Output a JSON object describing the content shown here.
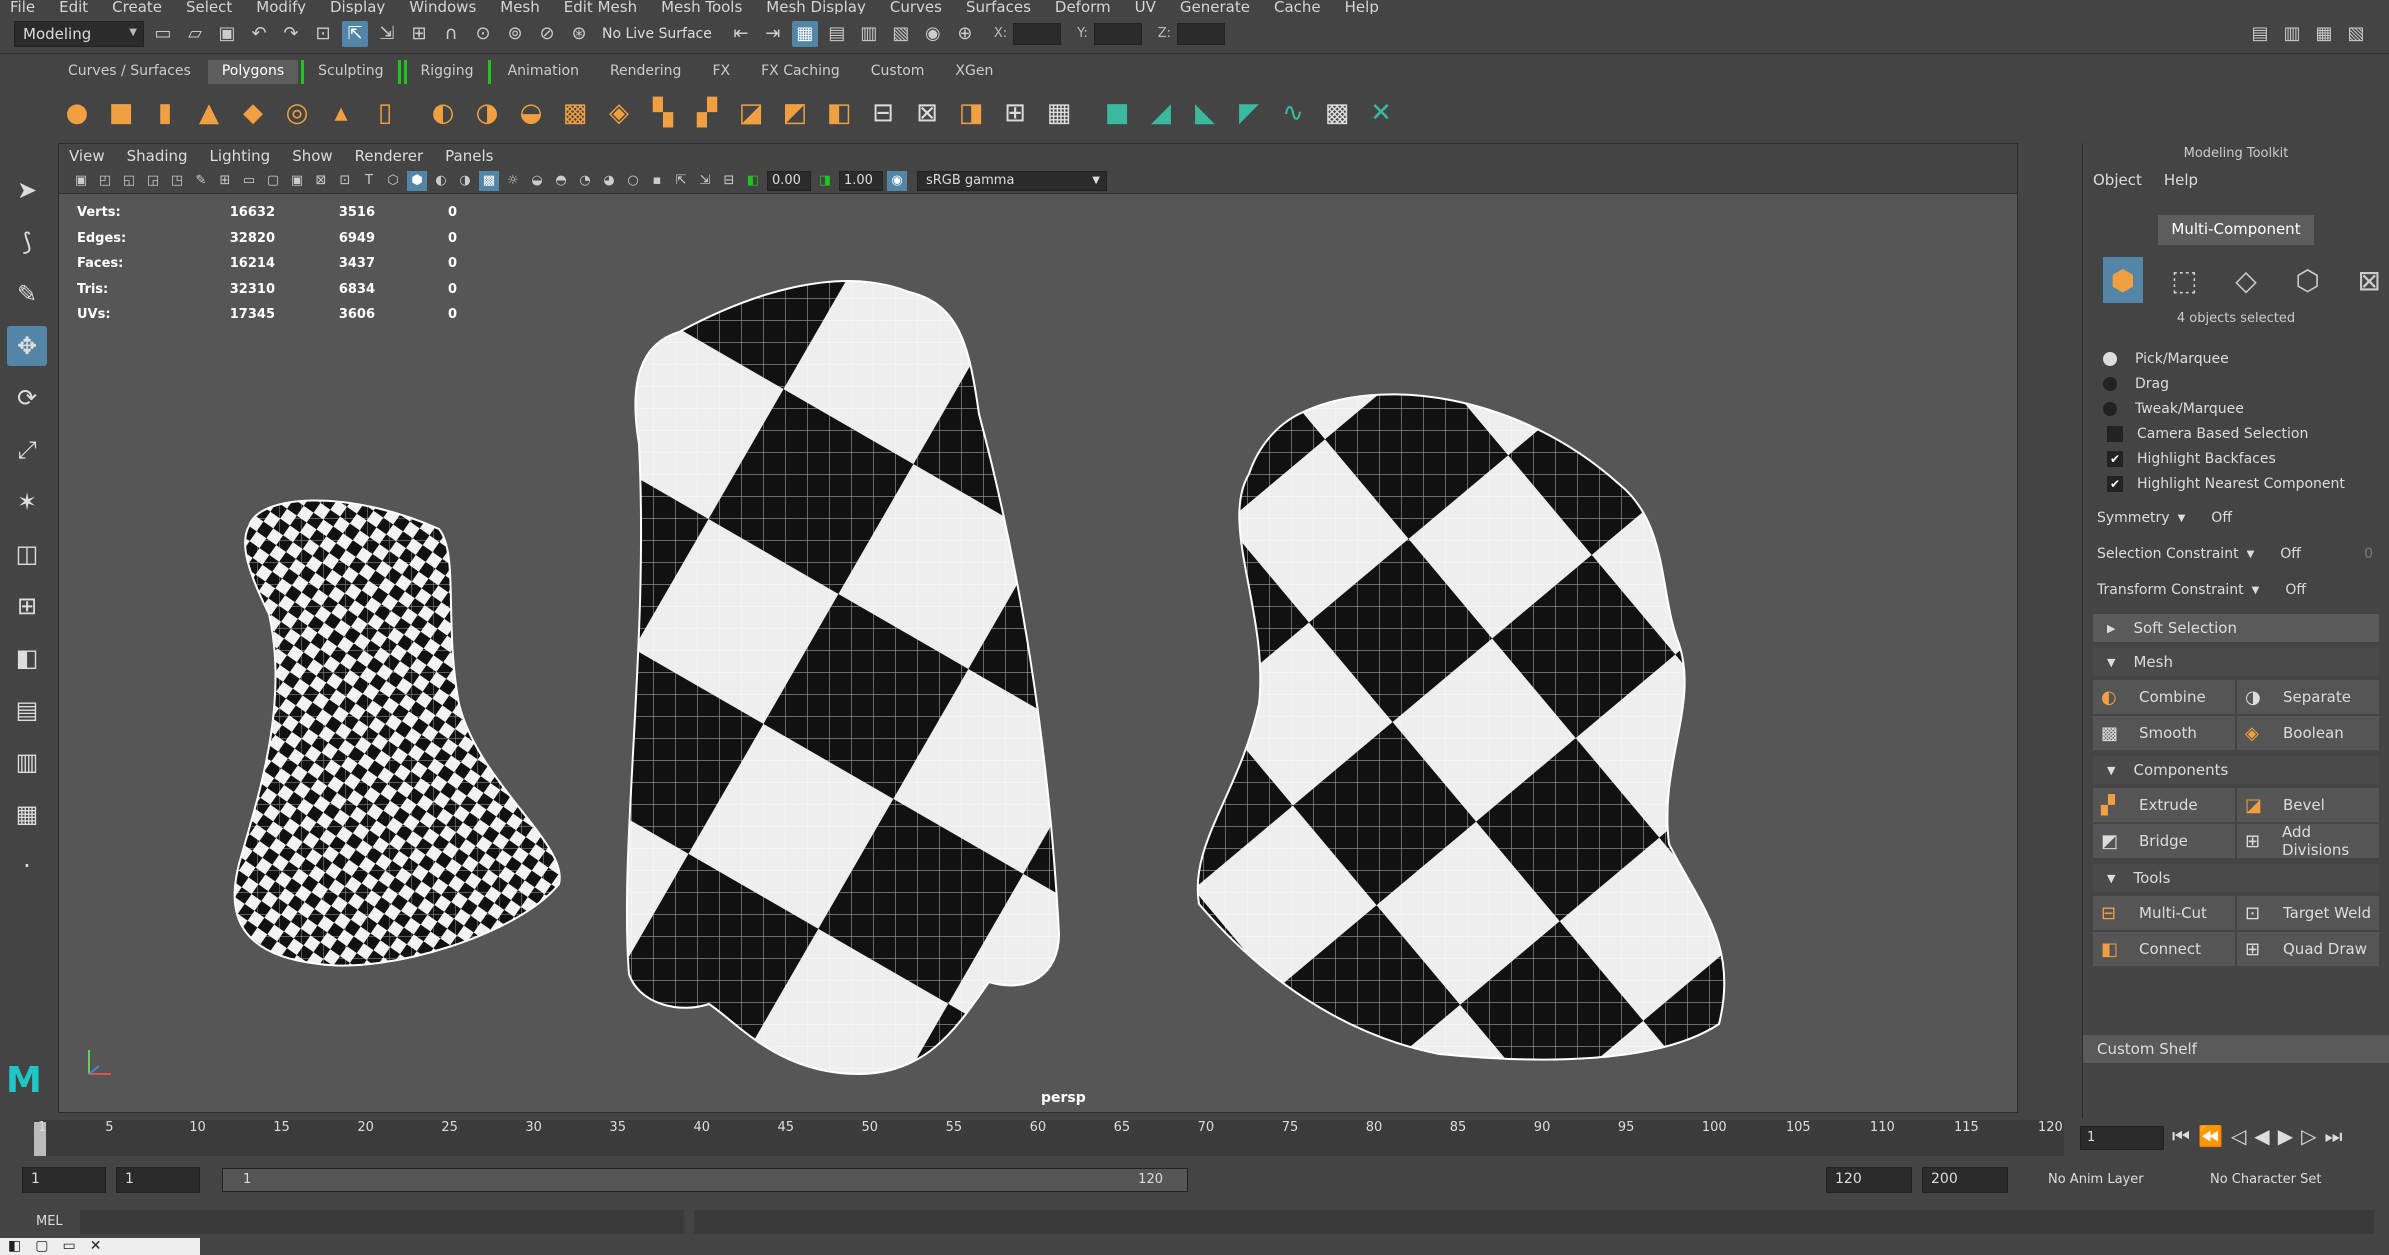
{
  "menubar": [
    "File",
    "Edit",
    "Create",
    "Select",
    "Modify",
    "Display",
    "Windows",
    "Mesh",
    "Edit Mesh",
    "Mesh Tools",
    "Mesh Display",
    "Curves",
    "Surfaces",
    "Deform",
    "UV",
    "Generate",
    "Cache",
    "Help"
  ],
  "statusline": {
    "mode": "Modeling",
    "live_surface": "No Live Surface",
    "x_label": "X:",
    "y_label": "Y:",
    "z_label": "Z:"
  },
  "shelf_tabs": [
    "Curves / Surfaces",
    "Polygons",
    "Sculpting",
    "Rigging",
    "Animation",
    "Rendering",
    "FX",
    "FX Caching",
    "Custom",
    "XGen"
  ],
  "viewport": {
    "menu": [
      "View",
      "Shading",
      "Lighting",
      "Show",
      "Renderer",
      "Panels"
    ],
    "exposure": "0.00",
    "gamma": "1.00",
    "color_space": "sRGB gamma",
    "camera": "persp",
    "hud": [
      {
        "label": "Verts:",
        "v1": "16632",
        "v2": "3516",
        "v3": "0"
      },
      {
        "label": "Edges:",
        "v1": "32820",
        "v2": "6949",
        "v3": "0"
      },
      {
        "label": "Faces:",
        "v1": "16214",
        "v2": "3437",
        "v3": "0"
      },
      {
        "label": "Tris:",
        "v1": "32310",
        "v2": "6834",
        "v3": "0"
      },
      {
        "label": "UVs:",
        "v1": "17345",
        "v2": "3606",
        "v3": "0"
      }
    ]
  },
  "toolkit": {
    "title": "Modeling Toolkit",
    "menu": [
      "Object",
      "Help"
    ],
    "multi_component": "Multi-Component",
    "objects_selected": "4 objects selected",
    "radios": [
      "Pick/Marquee",
      "Drag",
      "Tweak/Marquee"
    ],
    "checks": [
      {
        "label": "Camera Based Selection",
        "checked": false
      },
      {
        "label": "Highlight Backfaces",
        "checked": true
      },
      {
        "label": "Highlight Nearest Component",
        "checked": true
      }
    ],
    "symmetry": {
      "label": "Symmetry",
      "value": "Off"
    },
    "selection_constraint": {
      "label": "Selection Constraint",
      "value": "Off",
      "num": "0"
    },
    "transform_constraint": {
      "label": "Transform Constraint",
      "value": "Off"
    },
    "soft_selection": "Soft Selection",
    "mesh": {
      "title": "Mesh",
      "buttons": [
        "Combine",
        "Separate",
        "Smooth",
        "Boolean"
      ]
    },
    "components": {
      "title": "Components",
      "buttons": [
        "Extrude",
        "Bevel",
        "Bridge",
        "Add Divisions"
      ]
    },
    "tools": {
      "title": "Tools",
      "buttons": [
        "Multi-Cut",
        "Target Weld",
        "Connect",
        "Quad Draw"
      ]
    },
    "custom_shelf": "Custom Shelf"
  },
  "timeline": {
    "ticks": [
      "1",
      "5",
      "10",
      "15",
      "20",
      "25",
      "30",
      "35",
      "40",
      "45",
      "50",
      "55",
      "60",
      "65",
      "70",
      "75",
      "80",
      "85",
      "90",
      "95",
      "100",
      "105",
      "110",
      "115",
      "120"
    ],
    "current_frame": "1"
  },
  "range": {
    "start": "1",
    "playback_start": "1",
    "slider_start": "1",
    "slider_end": "120",
    "playback_end": "120",
    "end": "200",
    "anim_layer": "No Anim Layer",
    "character_set": "No Character Set"
  },
  "mel": "MEL"
}
